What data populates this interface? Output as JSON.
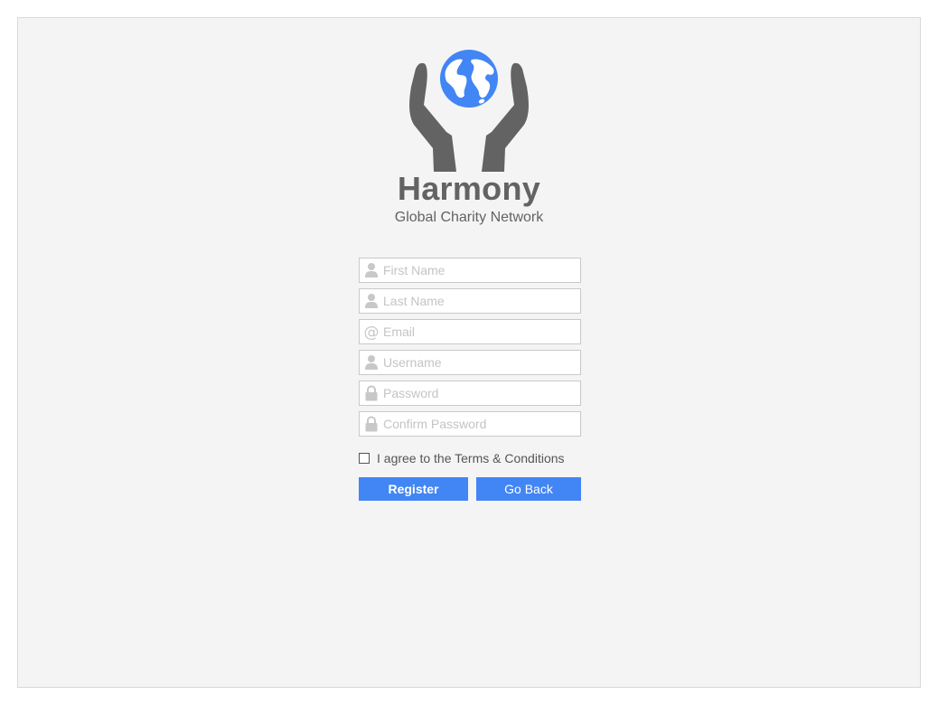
{
  "brand": {
    "title": "Harmony",
    "subtitle": "Global Charity Network",
    "logo_icon": "hands-holding-globe-icon",
    "colors": {
      "globe": "#4285f4",
      "hands": "#636363"
    }
  },
  "form": {
    "fields": [
      {
        "name": "first-name",
        "icon": "user-icon",
        "placeholder": "First Name",
        "value": ""
      },
      {
        "name": "last-name",
        "icon": "user-icon",
        "placeholder": "Last Name",
        "value": ""
      },
      {
        "name": "email",
        "icon": "at-sign-icon",
        "placeholder": "Email",
        "value": ""
      },
      {
        "name": "username",
        "icon": "user-icon",
        "placeholder": "Username",
        "value": ""
      },
      {
        "name": "password",
        "icon": "lock-icon",
        "placeholder": "Password",
        "value": ""
      },
      {
        "name": "confirm-password",
        "icon": "lock-icon",
        "placeholder": "Confirm Password",
        "value": ""
      }
    ],
    "agree_label": "I agree to the Terms & Conditions",
    "agree_checked": false,
    "register_label": "Register",
    "back_label": "Go Back"
  },
  "colors": {
    "accent": "#4285f4",
    "background": "#f4f4f4",
    "text": "#636363",
    "placeholder": "#c4c4c4",
    "icon": "#c8c8c8"
  }
}
